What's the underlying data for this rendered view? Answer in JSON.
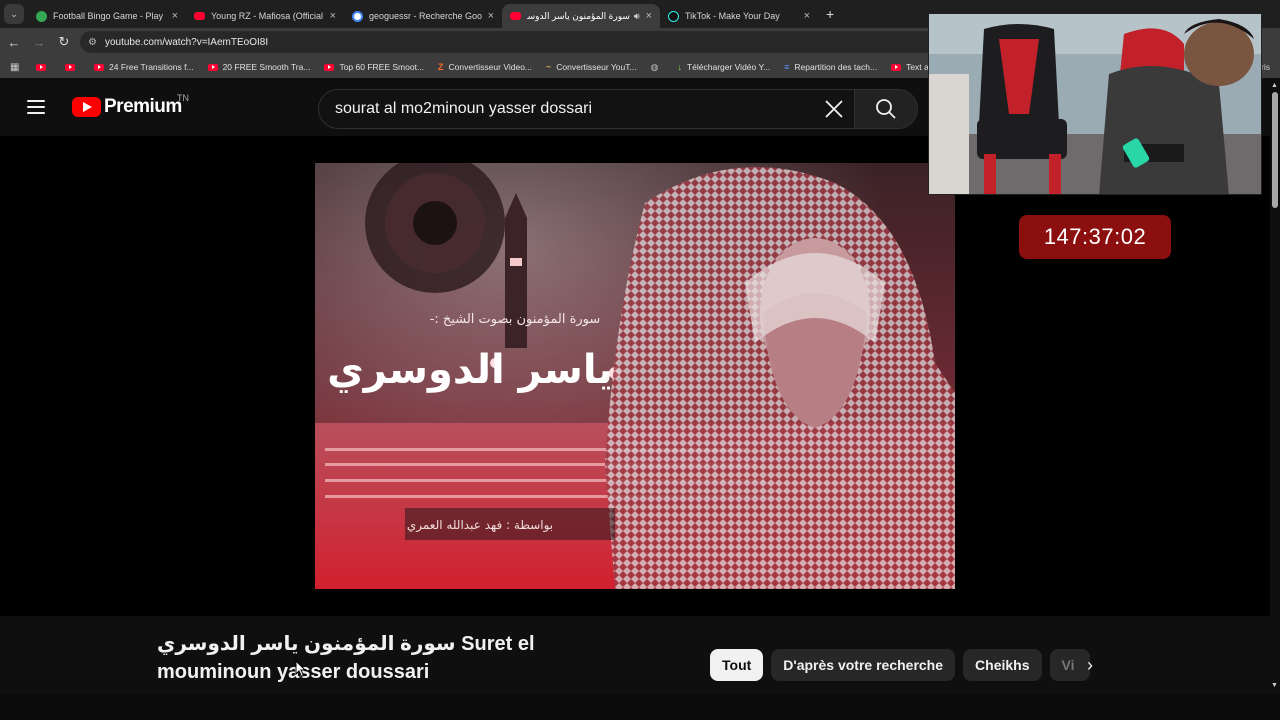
{
  "browser": {
    "tabs": [
      {
        "title": "Football Bingo Game - Play Now",
        "icon_color": "#34a853",
        "active": false
      },
      {
        "title": "Young RZ - Mafiosa (Official Music",
        "icon_color": "#ff0033",
        "active": false
      },
      {
        "title": "geoguessr - Recherche Google",
        "icon_color": "#4285f4",
        "active": false
      },
      {
        "title": "سورة المؤمنون ياسر الدوسري",
        "icon_color": "#ff0033",
        "active": true,
        "audio": true
      },
      {
        "title": "TikTok - Make Your Day",
        "icon_color": "#111111",
        "active": false
      }
    ],
    "url": "youtube.com/watch?v=IAemTEoOI8I",
    "bookmarks": [
      {
        "label": "",
        "icon": "youtube"
      },
      {
        "label": "",
        "icon": "youtube"
      },
      {
        "label": "24 Free Transitions f...",
        "icon": "youtube"
      },
      {
        "label": "20 FREE Smooth Tra...",
        "icon": "youtube"
      },
      {
        "label": "Top 60 FREE Smoot...",
        "icon": "youtube"
      },
      {
        "label": "Convertisseur Video...",
        "icon": "Z"
      },
      {
        "label": "Convertisseur YouT...",
        "icon": "~"
      },
      {
        "label": "Télécharger Vidéo Y...",
        "icon": "↓"
      },
      {
        "label": "Repartition des tach...",
        "icon": "≡"
      },
      {
        "label": "Text and Image ani...",
        "icon": "youtube"
      }
    ],
    "bookmarks_overflow": "ris"
  },
  "youtube": {
    "logo_text": "Premium",
    "country_code": "TN",
    "search_query": "sourat al mo2minoun yasser dossari",
    "video_title": "سورة المؤمنون ياسر الدوسري Suret el mouminoun yasser doussari",
    "chips": [
      {
        "label": "Tout",
        "active": true
      },
      {
        "label": "D'après votre recherche",
        "active": false
      },
      {
        "label": "Cheikhs",
        "active": false
      },
      {
        "label": "Vi",
        "active": false
      }
    ]
  },
  "thumbnail_text": {
    "subtitle": "سورة المؤمنون بصوت الشيخ :-",
    "name": "ياسر الدوسري",
    "credit": "بواسطة : فهد عبدالله العمري"
  },
  "overlay": {
    "timer": "147:37:02"
  },
  "colors": {
    "accent": "#ff0000",
    "timer_bg": "#8c0f10",
    "page_bg": "#0f0f0f"
  }
}
